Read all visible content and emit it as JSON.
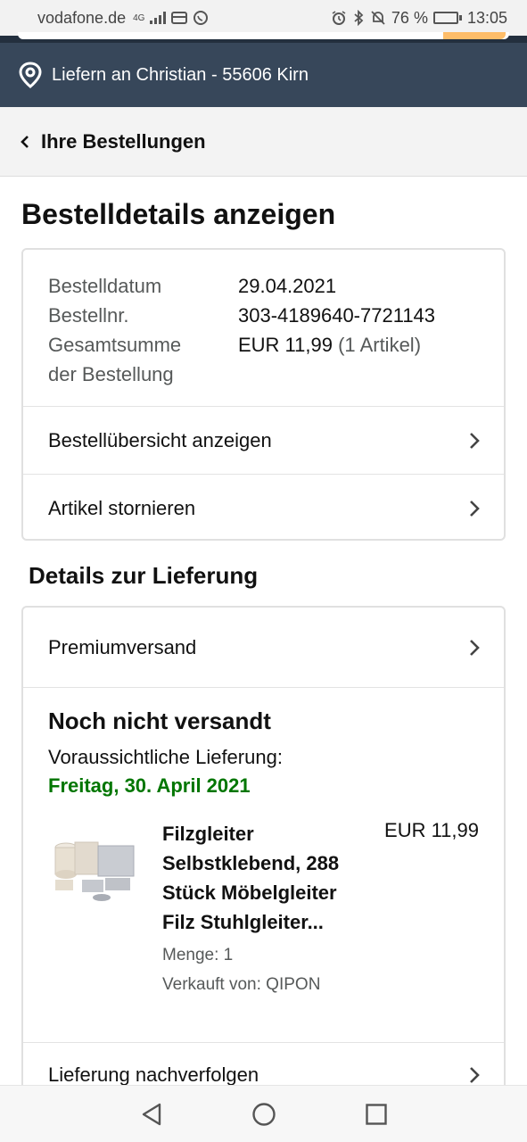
{
  "status_bar": {
    "carrier": "vodafone.de",
    "network": "4G",
    "battery": "76 %",
    "battery_level": 0.76,
    "time": "13:05"
  },
  "location": {
    "text": "Liefern an Christian - 55606 Kirn",
    "icon": "location-pin-icon"
  },
  "breadcrumb": {
    "label": "Ihre Bestellungen"
  },
  "page_title": "Bestelldetails anzeigen",
  "order": {
    "date_label": "Bestelldatum",
    "date_value": "29.04.2021",
    "number_label": "Bestellnr.",
    "number_value": "303-4189640-7721143",
    "total_label_1": "Gesamtsumme",
    "total_label_2": "der Bestellung",
    "total_value": "EUR 11,99",
    "total_count": "(1 Artikel)"
  },
  "actions": {
    "summary": "Bestellübersicht anzeigen",
    "cancel": "Artikel stornieren"
  },
  "delivery": {
    "section_title": "Details zur Lieferung",
    "shipping_method": "Premiumversand",
    "status": "Noch nicht versandt",
    "expected_label": "Voraussichtliche Lieferung:",
    "expected_date": "Freitag, 30. April 2021",
    "item": {
      "title": "Filzgleiter Selbstklebend, 288 Stück Möbelgleiter Filz Stuhlgleiter...",
      "price": "EUR 11,99",
      "quantity": "Menge: 1",
      "seller": "Verkauft von: QIPON"
    },
    "track": "Lieferung nachverfolgen"
  },
  "colors": {
    "header_dark": "#232f3e",
    "location_bar": "#37475a",
    "delivery_green": "#007600",
    "accent": "#febd69"
  }
}
